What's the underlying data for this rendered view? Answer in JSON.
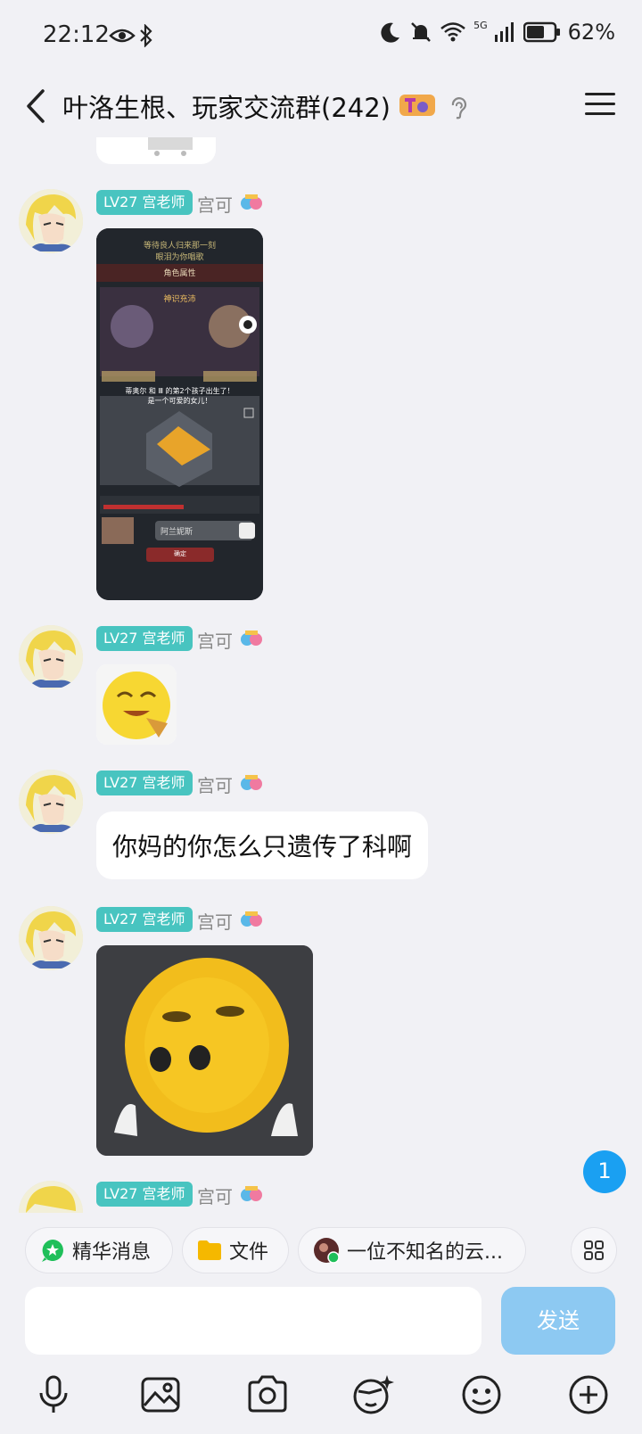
{
  "status_bar": {
    "time": "22:12",
    "network": "5G",
    "battery": "62%"
  },
  "header": {
    "title": "叶洛生根、玩家交流群(242)"
  },
  "messages": [
    {
      "badge": "LV27 宫老师",
      "nickname": "宫可",
      "type": "image"
    },
    {
      "badge": "LV27 宫老师",
      "nickname": "宫可",
      "type": "sticker"
    },
    {
      "badge": "LV27 宫老师",
      "nickname": "宫可",
      "type": "text",
      "text": "你妈的你怎么只遗传了科啊"
    },
    {
      "badge": "LV27 宫老师",
      "nickname": "宫可",
      "type": "sticker"
    },
    {
      "badge": "LV27 宫老师",
      "nickname": "宫可",
      "type": "partial"
    }
  ],
  "game_screenshot": {
    "top_line1": "等待良人归来那一刻",
    "top_line2": "眼泪为你唱歌",
    "panel_title": "角色属性",
    "event_title": "神识充沛",
    "birth_line1": "蒂奥尔 和 Ⅲ 的第2个孩子出生了！",
    "birth_line2": "是一个可爱的女儿！",
    "name_value": "阿兰妮斯",
    "confirm": "确定"
  },
  "unread_count": "1",
  "quick_bar": {
    "essence": "精华消息",
    "files": "文件",
    "user": "一位不知名的云..."
  },
  "composer": {
    "send": "发送"
  },
  "colors": {
    "badge": "#48c4c0",
    "send_disabled": "#8dc9f2",
    "unread": "#1aa0f2",
    "background": "#f1f1f5"
  }
}
